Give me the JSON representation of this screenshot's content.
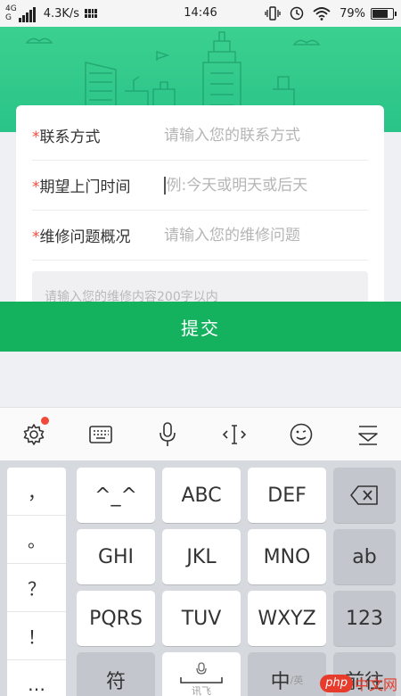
{
  "status_bar": {
    "network_top": "4G",
    "network_bottom": "G",
    "speed": "4.3K/s",
    "time": "14:46",
    "battery": "79%",
    "battery_level": 0.79
  },
  "form": {
    "contact_label": "联系方式",
    "contact_placeholder": "请输入您的联系方式",
    "visit_time_label": "期望上门时间",
    "visit_time_placeholder": "例:今天或明天或后天",
    "issue_label": "维修问题概况",
    "issue_placeholder": "请输入您的维修问题",
    "required_mark": "*",
    "details_placeholder": "请输入您的维修内容200字以内"
  },
  "submit_label": "提交",
  "ime_toolbar": {
    "icons": [
      "gear-icon",
      "keyboard-icon",
      "microphone-icon",
      "cursor-move-icon",
      "emoji-icon",
      "collapse-keyboard-icon"
    ]
  },
  "keyboard": {
    "side_symbols": [
      "，",
      "。",
      "？",
      "！",
      "…"
    ],
    "row1": [
      "^_^",
      "ABC",
      "DEF"
    ],
    "row2": [
      "GHI",
      "JKL",
      "MNO",
      "ab"
    ],
    "row3": [
      "PQRS",
      "TUV",
      "WXYZ",
      "123"
    ],
    "row4": {
      "symbol": "符",
      "space_hint": "讯飞",
      "lang_main": "中",
      "lang_sub": "/英",
      "enter": "前往"
    }
  },
  "watermark": {
    "logo": "php",
    "text": "中文网"
  },
  "colors": {
    "banner": "#2ac488",
    "submit": "#14b25f",
    "required": "#f04b3a"
  }
}
